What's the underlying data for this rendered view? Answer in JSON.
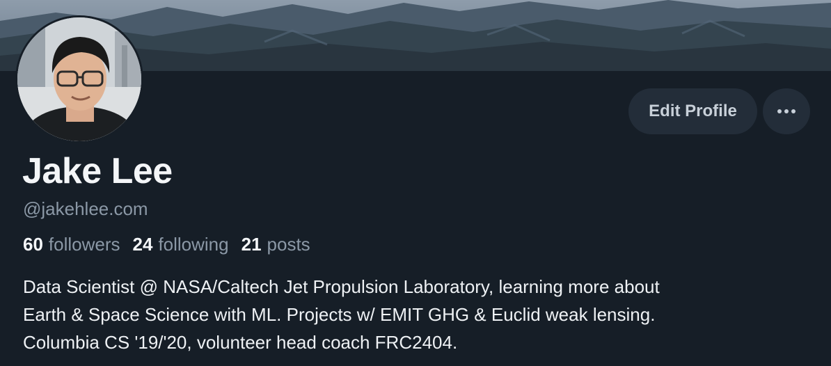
{
  "profile": {
    "display_name": "Jake Lee",
    "handle": "@jakehlee.com",
    "stats": [
      {
        "value": "60",
        "label": "followers"
      },
      {
        "value": "24",
        "label": "following"
      },
      {
        "value": "21",
        "label": "posts"
      }
    ],
    "bio_lines": [
      "Data Scientist @ NASA/Caltech Jet Propulsion Laboratory, learning more about",
      "Earth & Space Science with ML. Projects w/ EMIT GHG & Euclid weak lensing.",
      "Columbia CS '19/'20, volunteer head coach FRC2404."
    ]
  },
  "actions": {
    "edit_profile_label": "Edit Profile",
    "more_icon": "ellipsis-icon"
  },
  "colors": {
    "background": "#161e27",
    "button_bg": "#232d39",
    "muted_text": "#8b98a6",
    "primary_text": "#f4f6f8"
  }
}
